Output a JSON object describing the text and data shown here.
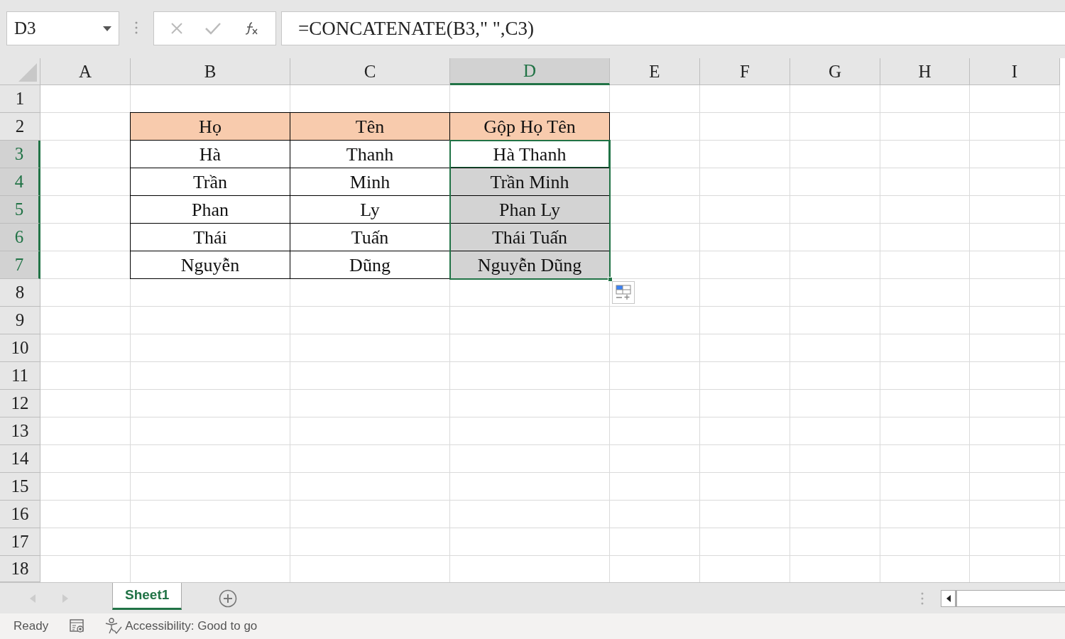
{
  "name_box": {
    "value": "D3"
  },
  "formula_bar": {
    "value": "=CONCATENATE(B3,\" \",C3)"
  },
  "columns": [
    {
      "label": "A",
      "selected": false
    },
    {
      "label": "B",
      "selected": false
    },
    {
      "label": "C",
      "selected": false
    },
    {
      "label": "D",
      "selected": true
    },
    {
      "label": "E",
      "selected": false
    },
    {
      "label": "F",
      "selected": false
    },
    {
      "label": "G",
      "selected": false
    },
    {
      "label": "H",
      "selected": false
    },
    {
      "label": "I",
      "selected": false
    }
  ],
  "rows": [
    {
      "label": "1",
      "selected": false
    },
    {
      "label": "2",
      "selected": false
    },
    {
      "label": "3",
      "selected": true
    },
    {
      "label": "4",
      "selected": true
    },
    {
      "label": "5",
      "selected": true
    },
    {
      "label": "6",
      "selected": true
    },
    {
      "label": "7",
      "selected": true
    },
    {
      "label": "8",
      "selected": false
    },
    {
      "label": "9",
      "selected": false
    },
    {
      "label": "10",
      "selected": false
    },
    {
      "label": "11",
      "selected": false
    },
    {
      "label": "12",
      "selected": false
    },
    {
      "label": "13",
      "selected": false
    },
    {
      "label": "14",
      "selected": false
    },
    {
      "label": "15",
      "selected": false
    },
    {
      "label": "16",
      "selected": false
    },
    {
      "label": "17",
      "selected": false
    },
    {
      "label": "18",
      "selected": false
    }
  ],
  "table": {
    "header": [
      "Họ",
      "Tên",
      "Gộp Họ Tên"
    ],
    "rows": [
      {
        "cells": [
          {
            "text": "Hà",
            "selected": false,
            "active": false
          },
          {
            "text": "Thanh",
            "selected": false,
            "active": false
          },
          {
            "text": "Hà Thanh",
            "selected": true,
            "active": true
          }
        ]
      },
      {
        "cells": [
          {
            "text": "Trần",
            "selected": false,
            "active": false
          },
          {
            "text": "Minh",
            "selected": false,
            "active": false
          },
          {
            "text": "Trần Minh",
            "selected": true,
            "active": false
          }
        ]
      },
      {
        "cells": [
          {
            "text": "Phan",
            "selected": false,
            "active": false
          },
          {
            "text": "Ly",
            "selected": false,
            "active": false
          },
          {
            "text": "Phan Ly",
            "selected": true,
            "active": false
          }
        ]
      },
      {
        "cells": [
          {
            "text": "Thái",
            "selected": false,
            "active": false
          },
          {
            "text": "Tuấn",
            "selected": false,
            "active": false
          },
          {
            "text": "Thái Tuấn",
            "selected": true,
            "active": false
          }
        ]
      },
      {
        "cells": [
          {
            "text": "Nguyễn",
            "selected": false,
            "active": false
          },
          {
            "text": "Dũng",
            "selected": false,
            "active": false
          },
          {
            "text": "Nguyễn Dũng",
            "selected": true,
            "active": false
          }
        ]
      }
    ]
  },
  "sheet_tabs": [
    {
      "label": "Sheet1",
      "selected": true
    }
  ],
  "status_bar": {
    "mode": "Ready",
    "accessibility": "Accessibility: Good to go"
  }
}
